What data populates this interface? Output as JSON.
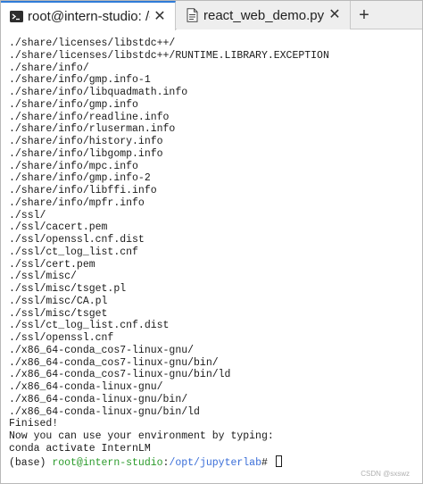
{
  "tabs": [
    {
      "label": "root@intern-studio: /opt/j",
      "icon": "terminal-icon",
      "active": true
    },
    {
      "label": "react_web_demo.py",
      "icon": "file-icon",
      "active": false
    }
  ],
  "new_tab_label": "+",
  "close_label": "✕",
  "terminal": {
    "lines": [
      "./share/licenses/libstdc++/",
      "./share/licenses/libstdc++/RUNTIME.LIBRARY.EXCEPTION",
      "./share/info/",
      "./share/info/gmp.info-1",
      "./share/info/libquadmath.info",
      "./share/info/gmp.info",
      "./share/info/readline.info",
      "./share/info/rluserman.info",
      "./share/info/history.info",
      "./share/info/libgomp.info",
      "./share/info/mpc.info",
      "./share/info/gmp.info-2",
      "./share/info/libffi.info",
      "./share/info/mpfr.info",
      "./ssl/",
      "./ssl/cacert.pem",
      "./ssl/openssl.cnf.dist",
      "./ssl/ct_log_list.cnf",
      "./ssl/cert.pem",
      "./ssl/misc/",
      "./ssl/misc/tsget.pl",
      "./ssl/misc/CA.pl",
      "./ssl/misc/tsget",
      "./ssl/ct_log_list.cnf.dist",
      "./ssl/openssl.cnf",
      "./x86_64-conda_cos7-linux-gnu/",
      "./x86_64-conda_cos7-linux-gnu/bin/",
      "./x86_64-conda_cos7-linux-gnu/bin/ld",
      "./x86_64-conda-linux-gnu/",
      "./x86_64-conda-linux-gnu/bin/",
      "./x86_64-conda-linux-gnu/bin/ld",
      "Finised!",
      "Now you can use your environment by typing:",
      "conda activate InternLM"
    ],
    "prompt": {
      "env": "(base) ",
      "user_host": "root@intern-studio",
      "sep": ":",
      "path": "/opt/jupyterlab",
      "symbol": "# "
    }
  },
  "watermark": "CSDN @sxswz",
  "colors": {
    "accent": "#2f7bd8",
    "prompt_user": "#2b9b2b",
    "prompt_path": "#3a6ed8"
  }
}
